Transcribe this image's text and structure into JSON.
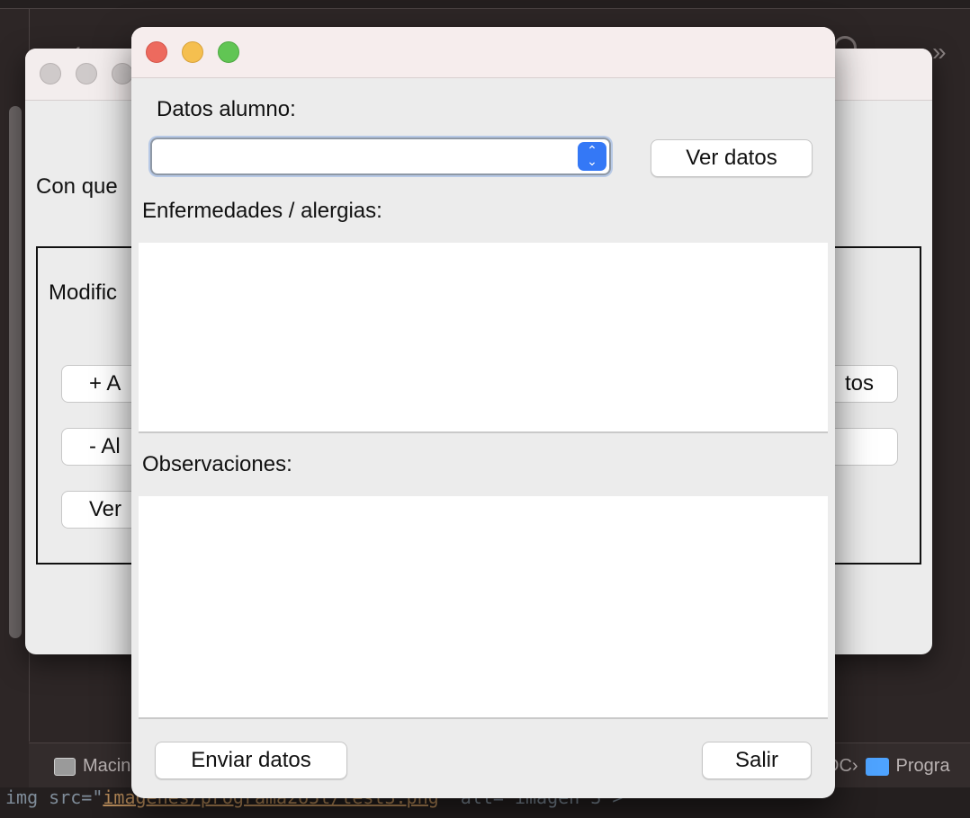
{
  "ide": {
    "pathbar": {
      "left_item": "Macin",
      "right_suffix": "DC›",
      "right_item": "Progra"
    },
    "code_line": {
      "prefix": "img src=\"",
      "path": "imagenes/programa2o5t/test3.png",
      "suffix": "\" alt=\"imagen 3\">"
    }
  },
  "back_window": {
    "partial_text": "Con que",
    "group_label": "Modific",
    "buttons": {
      "add": "+ A",
      "remove": "- Al",
      "view": "Ver",
      "right": "tos"
    }
  },
  "dialog": {
    "student_label": "Datos alumno:",
    "student_combo": {
      "selected": "",
      "options": []
    },
    "view_data_button": "Ver datos",
    "diseases_label": "Enfermedades / alergias:",
    "diseases_value": "",
    "observations_label": "Observaciones:",
    "observations_value": "",
    "send_button": "Enviar datos",
    "exit_button": "Salir"
  },
  "colors": {
    "close": "#ed6a5e",
    "minimize": "#f5bf4f",
    "zoom": "#61c554",
    "combo_accent": "#3478f6"
  }
}
